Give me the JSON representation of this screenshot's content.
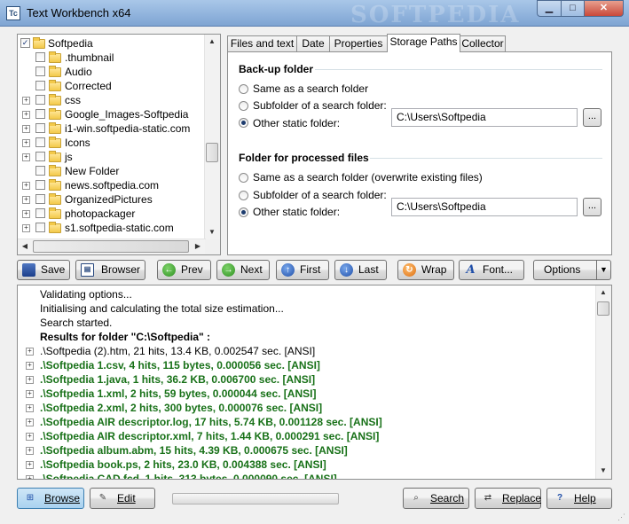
{
  "window": {
    "title": "Text Workbench x64",
    "watermark": "SOFTPEDIA",
    "minimize_glyph": "▁",
    "maximize_glyph": "□",
    "close_glyph": "✕"
  },
  "tree": {
    "root": "Softpedia",
    "items": [
      {
        "label": ".thumbnail",
        "expandable": false
      },
      {
        "label": "Audio",
        "expandable": false
      },
      {
        "label": "Corrected",
        "expandable": false
      },
      {
        "label": "css",
        "expandable": true
      },
      {
        "label": "Google_Images-Softpedia",
        "expandable": true
      },
      {
        "label": "i1-win.softpedia-static.com",
        "expandable": true
      },
      {
        "label": "Icons",
        "expandable": true
      },
      {
        "label": "js",
        "expandable": true
      },
      {
        "label": "New Folder",
        "expandable": false
      },
      {
        "label": "news.softpedia.com",
        "expandable": true
      },
      {
        "label": "OrganizedPictures",
        "expandable": true
      },
      {
        "label": "photopackager",
        "expandable": true
      },
      {
        "label": "s1.softpedia-static.com",
        "expandable": true
      }
    ]
  },
  "tabs": [
    "Files and text",
    "Date",
    "Properties",
    "Storage Paths",
    "Collector"
  ],
  "active_tab": "Storage Paths",
  "backup": {
    "title": "Back-up folder",
    "options": [
      "Same as a search folder",
      "Subfolder of a search folder:",
      "Other static folder:"
    ],
    "selected": 2,
    "path": "C:\\Users\\Softpedia",
    "browse_label": "..."
  },
  "processed": {
    "title": "Folder for processed files",
    "options": [
      "Same as a search folder (overwrite existing files)",
      "Subfolder of a search folder:",
      "Other static folder:"
    ],
    "selected": 2,
    "path": "C:\\Users\\Softpedia",
    "browse_label": "..."
  },
  "toolbar": {
    "save": "Save",
    "browser": "Browser",
    "prev": "Prev",
    "next": "Next",
    "first": "First",
    "last": "Last",
    "wrap": "Wrap",
    "font": "Font...",
    "options": "Options"
  },
  "results": [
    {
      "text": "Validating options...",
      "kind": "log"
    },
    {
      "text": "Initialising and calculating the total size estimation...",
      "kind": "log"
    },
    {
      "text": "Search started.",
      "kind": "log"
    },
    {
      "text": "Results for folder \"C:\\Softpedia\" :",
      "kind": "folder"
    },
    {
      "text": ".\\Softpedia (2).htm, 21 hits, 13.4 KB, 0.002547 sec. [ANSI]",
      "kind": "file"
    },
    {
      "text": ".\\Softpedia 1.csv, 4 hits, 115 bytes, 0.000056 sec. [ANSI]",
      "kind": "hit"
    },
    {
      "text": ".\\Softpedia 1.java, 1 hits, 36.2 KB, 0.006700 sec. [ANSI]",
      "kind": "hit"
    },
    {
      "text": ".\\Softpedia 1.xml, 2 hits, 59 bytes, 0.000044 sec. [ANSI]",
      "kind": "hit"
    },
    {
      "text": ".\\Softpedia 2.xml, 2 hits, 300 bytes, 0.000076 sec. [ANSI]",
      "kind": "hit"
    },
    {
      "text": ".\\Softpedia AIR descriptor.log, 17 hits, 5.74 KB, 0.001128 sec. [ANSI]",
      "kind": "hit"
    },
    {
      "text": ".\\Softpedia AIR descriptor.xml, 7 hits, 1.44 KB, 0.000291 sec. [ANSI]",
      "kind": "hit"
    },
    {
      "text": ".\\Softpedia album.abm, 15 hits, 4.39 KB, 0.000675 sec. [ANSI]",
      "kind": "hit"
    },
    {
      "text": ".\\Softpedia book.ps, 2 hits, 23.0 KB, 0.004388 sec. [ANSI]",
      "kind": "hit"
    },
    {
      "text": ".\\Softpedia CAD.fcd, 1 hits, 313 bytes, 0.000090 sec. [ANSI]",
      "kind": "hit"
    }
  ],
  "bottom": {
    "browse": "Browse",
    "edit": "Edit",
    "search": "Search",
    "replace": "Replace",
    "help": "Help",
    "progress": 0
  }
}
